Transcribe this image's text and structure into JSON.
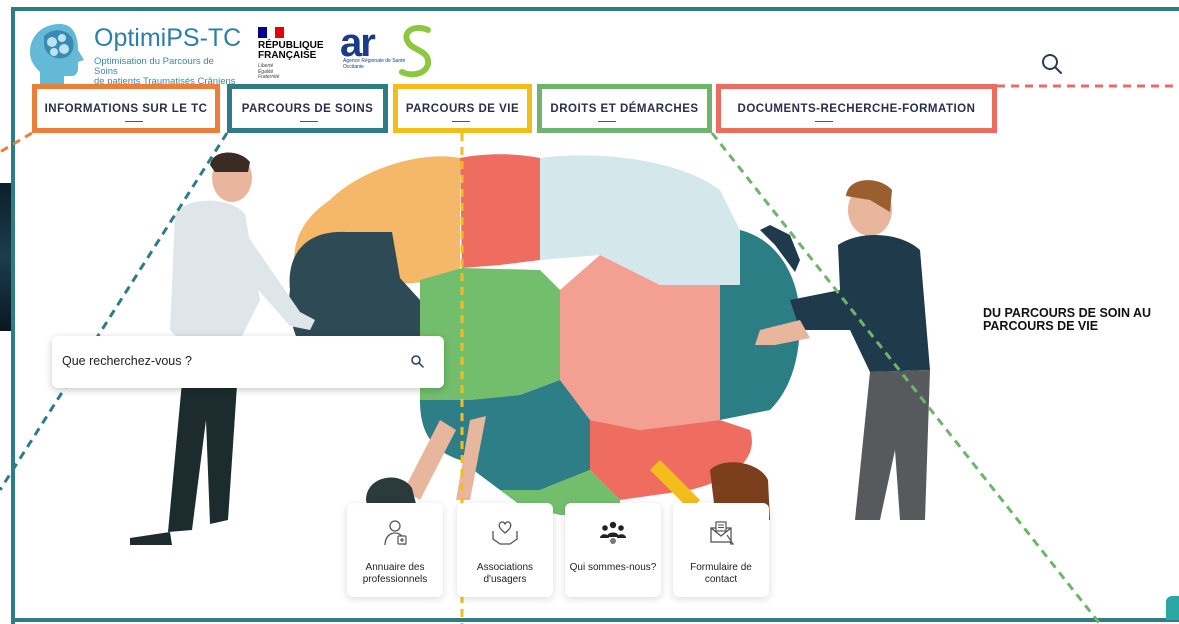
{
  "brand": {
    "name": "OptimiPS-TC",
    "tagline": "Optimisation du Parcours de Soins\nde patients Traumatisés Crâniens"
  },
  "republique": {
    "name": "RÉPUBLIQUE\nFRANÇAISE",
    "motto": "Liberté\nÉgalité\nFraternité"
  },
  "ars": {
    "logo_text": "ars",
    "subtitle": "Agence Régionale de Santé\nOccitanie"
  },
  "nav": [
    {
      "label": "INFORMATIONS SUR LE TC",
      "color": "#ea7e3a"
    },
    {
      "label": "PARCOURS DE SOINS",
      "color": "#2f7c86"
    },
    {
      "label": "PARCOURS DE VIE",
      "color": "#f3be1d"
    },
    {
      "label": "DROITS ET DÉMARCHES",
      "color": "#6fb36c"
    },
    {
      "label": "DOCUMENTS-RECHERCHE-FORMATION",
      "color": "#ee6b63"
    }
  ],
  "search": {
    "placeholder": "Que recherchez-vous ?",
    "icon": "search-icon"
  },
  "hero": {
    "tagline": "DU PARCOURS DE SOIN AU PARCOURS DE VIE"
  },
  "quick_links": [
    {
      "label": "Annuaire des\nprofessionnels",
      "icon": "doctor-icon"
    },
    {
      "label": "Associations\nd'usagers",
      "icon": "heart-hands-icon"
    },
    {
      "label": "Qui sommes-nous?",
      "icon": "group-icon"
    },
    {
      "label": "Formulaire de\ncontact",
      "icon": "mail-icon"
    }
  ],
  "colors": {
    "frame": "#2f7c86",
    "brand_blue": "#2f7fa4",
    "ars_blue": "#1a3a8a",
    "ars_green": "#8dc63f"
  }
}
